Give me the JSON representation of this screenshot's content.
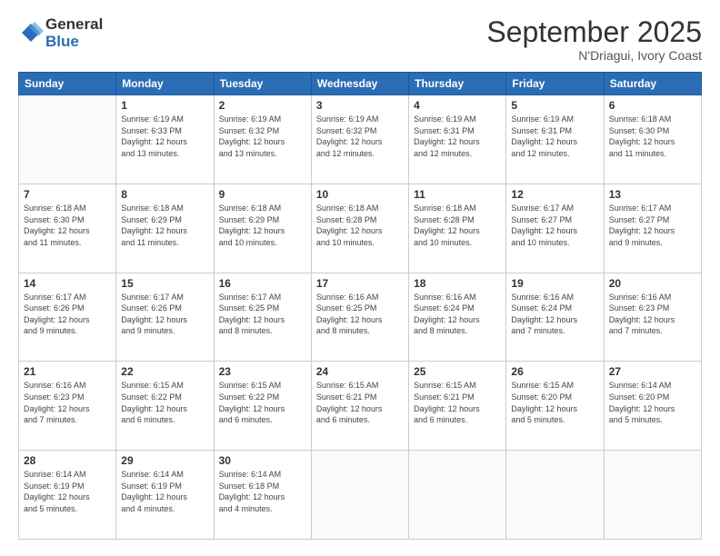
{
  "logo": {
    "general": "General",
    "blue": "Blue"
  },
  "header": {
    "title": "September 2025",
    "subtitle": "N'Driagui, Ivory Coast"
  },
  "weekdays": [
    "Sunday",
    "Monday",
    "Tuesday",
    "Wednesday",
    "Thursday",
    "Friday",
    "Saturday"
  ],
  "weeks": [
    [
      {
        "day": "",
        "info": ""
      },
      {
        "day": "1",
        "info": "Sunrise: 6:19 AM\nSunset: 6:33 PM\nDaylight: 12 hours\nand 13 minutes."
      },
      {
        "day": "2",
        "info": "Sunrise: 6:19 AM\nSunset: 6:32 PM\nDaylight: 12 hours\nand 13 minutes."
      },
      {
        "day": "3",
        "info": "Sunrise: 6:19 AM\nSunset: 6:32 PM\nDaylight: 12 hours\nand 12 minutes."
      },
      {
        "day": "4",
        "info": "Sunrise: 6:19 AM\nSunset: 6:31 PM\nDaylight: 12 hours\nand 12 minutes."
      },
      {
        "day": "5",
        "info": "Sunrise: 6:19 AM\nSunset: 6:31 PM\nDaylight: 12 hours\nand 12 minutes."
      },
      {
        "day": "6",
        "info": "Sunrise: 6:18 AM\nSunset: 6:30 PM\nDaylight: 12 hours\nand 11 minutes."
      }
    ],
    [
      {
        "day": "7",
        "info": "Sunrise: 6:18 AM\nSunset: 6:30 PM\nDaylight: 12 hours\nand 11 minutes."
      },
      {
        "day": "8",
        "info": "Sunrise: 6:18 AM\nSunset: 6:29 PM\nDaylight: 12 hours\nand 11 minutes."
      },
      {
        "day": "9",
        "info": "Sunrise: 6:18 AM\nSunset: 6:29 PM\nDaylight: 12 hours\nand 10 minutes."
      },
      {
        "day": "10",
        "info": "Sunrise: 6:18 AM\nSunset: 6:28 PM\nDaylight: 12 hours\nand 10 minutes."
      },
      {
        "day": "11",
        "info": "Sunrise: 6:18 AM\nSunset: 6:28 PM\nDaylight: 12 hours\nand 10 minutes."
      },
      {
        "day": "12",
        "info": "Sunrise: 6:17 AM\nSunset: 6:27 PM\nDaylight: 12 hours\nand 10 minutes."
      },
      {
        "day": "13",
        "info": "Sunrise: 6:17 AM\nSunset: 6:27 PM\nDaylight: 12 hours\nand 9 minutes."
      }
    ],
    [
      {
        "day": "14",
        "info": "Sunrise: 6:17 AM\nSunset: 6:26 PM\nDaylight: 12 hours\nand 9 minutes."
      },
      {
        "day": "15",
        "info": "Sunrise: 6:17 AM\nSunset: 6:26 PM\nDaylight: 12 hours\nand 9 minutes."
      },
      {
        "day": "16",
        "info": "Sunrise: 6:17 AM\nSunset: 6:25 PM\nDaylight: 12 hours\nand 8 minutes."
      },
      {
        "day": "17",
        "info": "Sunrise: 6:16 AM\nSunset: 6:25 PM\nDaylight: 12 hours\nand 8 minutes."
      },
      {
        "day": "18",
        "info": "Sunrise: 6:16 AM\nSunset: 6:24 PM\nDaylight: 12 hours\nand 8 minutes."
      },
      {
        "day": "19",
        "info": "Sunrise: 6:16 AM\nSunset: 6:24 PM\nDaylight: 12 hours\nand 7 minutes."
      },
      {
        "day": "20",
        "info": "Sunrise: 6:16 AM\nSunset: 6:23 PM\nDaylight: 12 hours\nand 7 minutes."
      }
    ],
    [
      {
        "day": "21",
        "info": "Sunrise: 6:16 AM\nSunset: 6:23 PM\nDaylight: 12 hours\nand 7 minutes."
      },
      {
        "day": "22",
        "info": "Sunrise: 6:15 AM\nSunset: 6:22 PM\nDaylight: 12 hours\nand 6 minutes."
      },
      {
        "day": "23",
        "info": "Sunrise: 6:15 AM\nSunset: 6:22 PM\nDaylight: 12 hours\nand 6 minutes."
      },
      {
        "day": "24",
        "info": "Sunrise: 6:15 AM\nSunset: 6:21 PM\nDaylight: 12 hours\nand 6 minutes."
      },
      {
        "day": "25",
        "info": "Sunrise: 6:15 AM\nSunset: 6:21 PM\nDaylight: 12 hours\nand 6 minutes."
      },
      {
        "day": "26",
        "info": "Sunrise: 6:15 AM\nSunset: 6:20 PM\nDaylight: 12 hours\nand 5 minutes."
      },
      {
        "day": "27",
        "info": "Sunrise: 6:14 AM\nSunset: 6:20 PM\nDaylight: 12 hours\nand 5 minutes."
      }
    ],
    [
      {
        "day": "28",
        "info": "Sunrise: 6:14 AM\nSunset: 6:19 PM\nDaylight: 12 hours\nand 5 minutes."
      },
      {
        "day": "29",
        "info": "Sunrise: 6:14 AM\nSunset: 6:19 PM\nDaylight: 12 hours\nand 4 minutes."
      },
      {
        "day": "30",
        "info": "Sunrise: 6:14 AM\nSunset: 6:18 PM\nDaylight: 12 hours\nand 4 minutes."
      },
      {
        "day": "",
        "info": ""
      },
      {
        "day": "",
        "info": ""
      },
      {
        "day": "",
        "info": ""
      },
      {
        "day": "",
        "info": ""
      }
    ]
  ]
}
